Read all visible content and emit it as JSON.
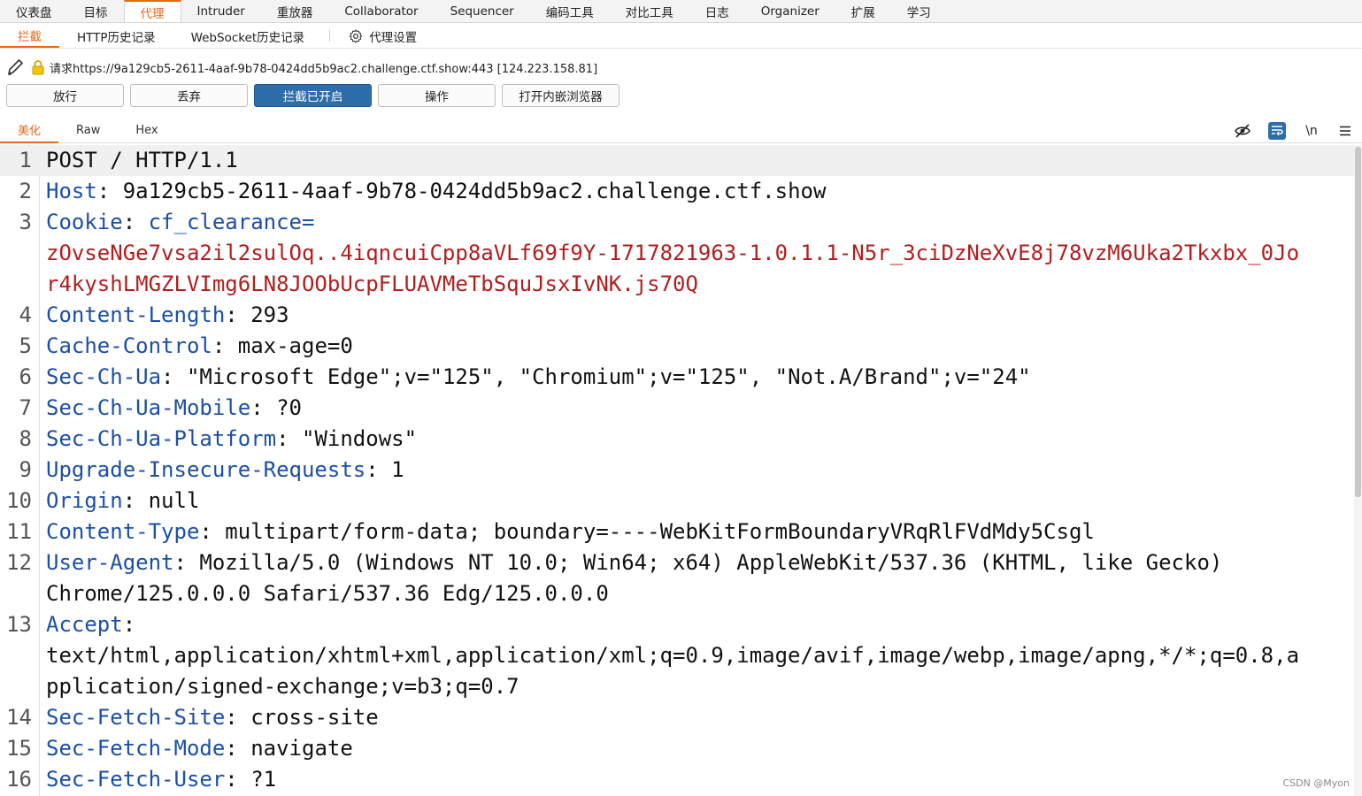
{
  "top_tabs": [
    "仪表盘",
    "目标",
    "代理",
    "Intruder",
    "重放器",
    "Collaborator",
    "Sequencer",
    "编码工具",
    "对比工具",
    "日志",
    "Organizer",
    "扩展",
    "学习"
  ],
  "sub_tabs": {
    "intercept": "拦截",
    "http_history": "HTTP历史记录",
    "websocket_history": "WebSocket历史记录",
    "proxy_settings": "代理设置"
  },
  "request_info": "请求https://9a129cb5-2611-4aaf-9b78-0424dd5b9ac2.challenge.ctf.show:443  [124.223.158.81]",
  "buttons": {
    "forward": "放行",
    "drop": "丢弃",
    "intercept_on": "拦截已开启",
    "action": "操作",
    "open_browser": "打开内嵌浏览器"
  },
  "editor_tabs": {
    "pretty": "美化",
    "raw": "Raw",
    "hex": "Hex",
    "newline_toggle": "\\n"
  },
  "lines": [
    {
      "num": "1",
      "key": "",
      "sep": "",
      "val": "POST / HTTP/1.1"
    },
    {
      "num": "2",
      "key": "Host",
      "sep": ": ",
      "val": "9a129cb5-2611-4aaf-9b78-0424dd5b9ac2.challenge.ctf.show"
    },
    {
      "num": "3",
      "key": "Cookie",
      "sep": ": ",
      "val": ""
    },
    {
      "num": "",
      "key": "",
      "sep": "",
      "val": "zOvseNGe7vsa2il2sulOq..4iqncuiCpp8aVLf69f9Y-1717821963-1.0.1.1-N5r_3ciDzNeXvE8j78vzM6Uka2Tkxbx_0Jo"
    },
    {
      "num": "",
      "key": "",
      "sep": "",
      "val": "r4kyshLMGZLVImg6LN8JOObUcpFLUAVMeTbSquJsxIvNK.js70Q"
    },
    {
      "num": "4",
      "key": "Content-Length",
      "sep": ": ",
      "val": "293"
    },
    {
      "num": "5",
      "key": "Cache-Control",
      "sep": ": ",
      "val": "max-age=0"
    },
    {
      "num": "6",
      "key": "Sec-Ch-Ua",
      "sep": ": ",
      "val": "\"Microsoft Edge\";v=\"125\", \"Chromium\";v=\"125\", \"Not.A/Brand\";v=\"24\""
    },
    {
      "num": "7",
      "key": "Sec-Ch-Ua-Mobile",
      "sep": ": ",
      "val": "?0"
    },
    {
      "num": "8",
      "key": "Sec-Ch-Ua-Platform",
      "sep": ": ",
      "val": "\"Windows\""
    },
    {
      "num": "9",
      "key": "Upgrade-Insecure-Requests",
      "sep": ": ",
      "val": "1"
    },
    {
      "num": "10",
      "key": "Origin",
      "sep": ": ",
      "val": "null"
    },
    {
      "num": "11",
      "key": "Content-Type",
      "sep": ": ",
      "val": "multipart/form-data; boundary=----WebKitFormBoundaryVRqRlFVdMdy5Csgl"
    },
    {
      "num": "12",
      "key": "User-Agent",
      "sep": ": ",
      "val": "Mozilla/5.0 (Windows NT 10.0; Win64; x64) AppleWebKit/537.36 (KHTML, like Gecko)"
    },
    {
      "num": "",
      "key": "",
      "sep": "",
      "val": "Chrome/125.0.0.0 Safari/537.36 Edg/125.0.0.0"
    },
    {
      "num": "13",
      "key": "Accept",
      "sep": ":",
      "val": ""
    },
    {
      "num": "",
      "key": "",
      "sep": "",
      "val": "text/html,application/xhtml+xml,application/xml;q=0.9,image/avif,image/webp,image/apng,*/*;q=0.8,a"
    },
    {
      "num": "",
      "key": "",
      "sep": "",
      "val": "pplication/signed-exchange;v=b3;q=0.7"
    },
    {
      "num": "14",
      "key": "Sec-Fetch-Site",
      "sep": ": ",
      "val": "cross-site"
    },
    {
      "num": "15",
      "key": "Sec-Fetch-Mode",
      "sep": ": ",
      "val": "navigate"
    },
    {
      "num": "16",
      "key": "Sec-Fetch-User",
      "sep": ": ",
      "val": "?1"
    }
  ],
  "cookie_name": "cf_clearance=",
  "watermark": "CSDN @Myon⁠",
  "colors": {
    "accent": "#e8671a",
    "header_key": "#1b4fa6",
    "cookie_value": "#b01e1e",
    "button_on": "#2d6eaa"
  }
}
